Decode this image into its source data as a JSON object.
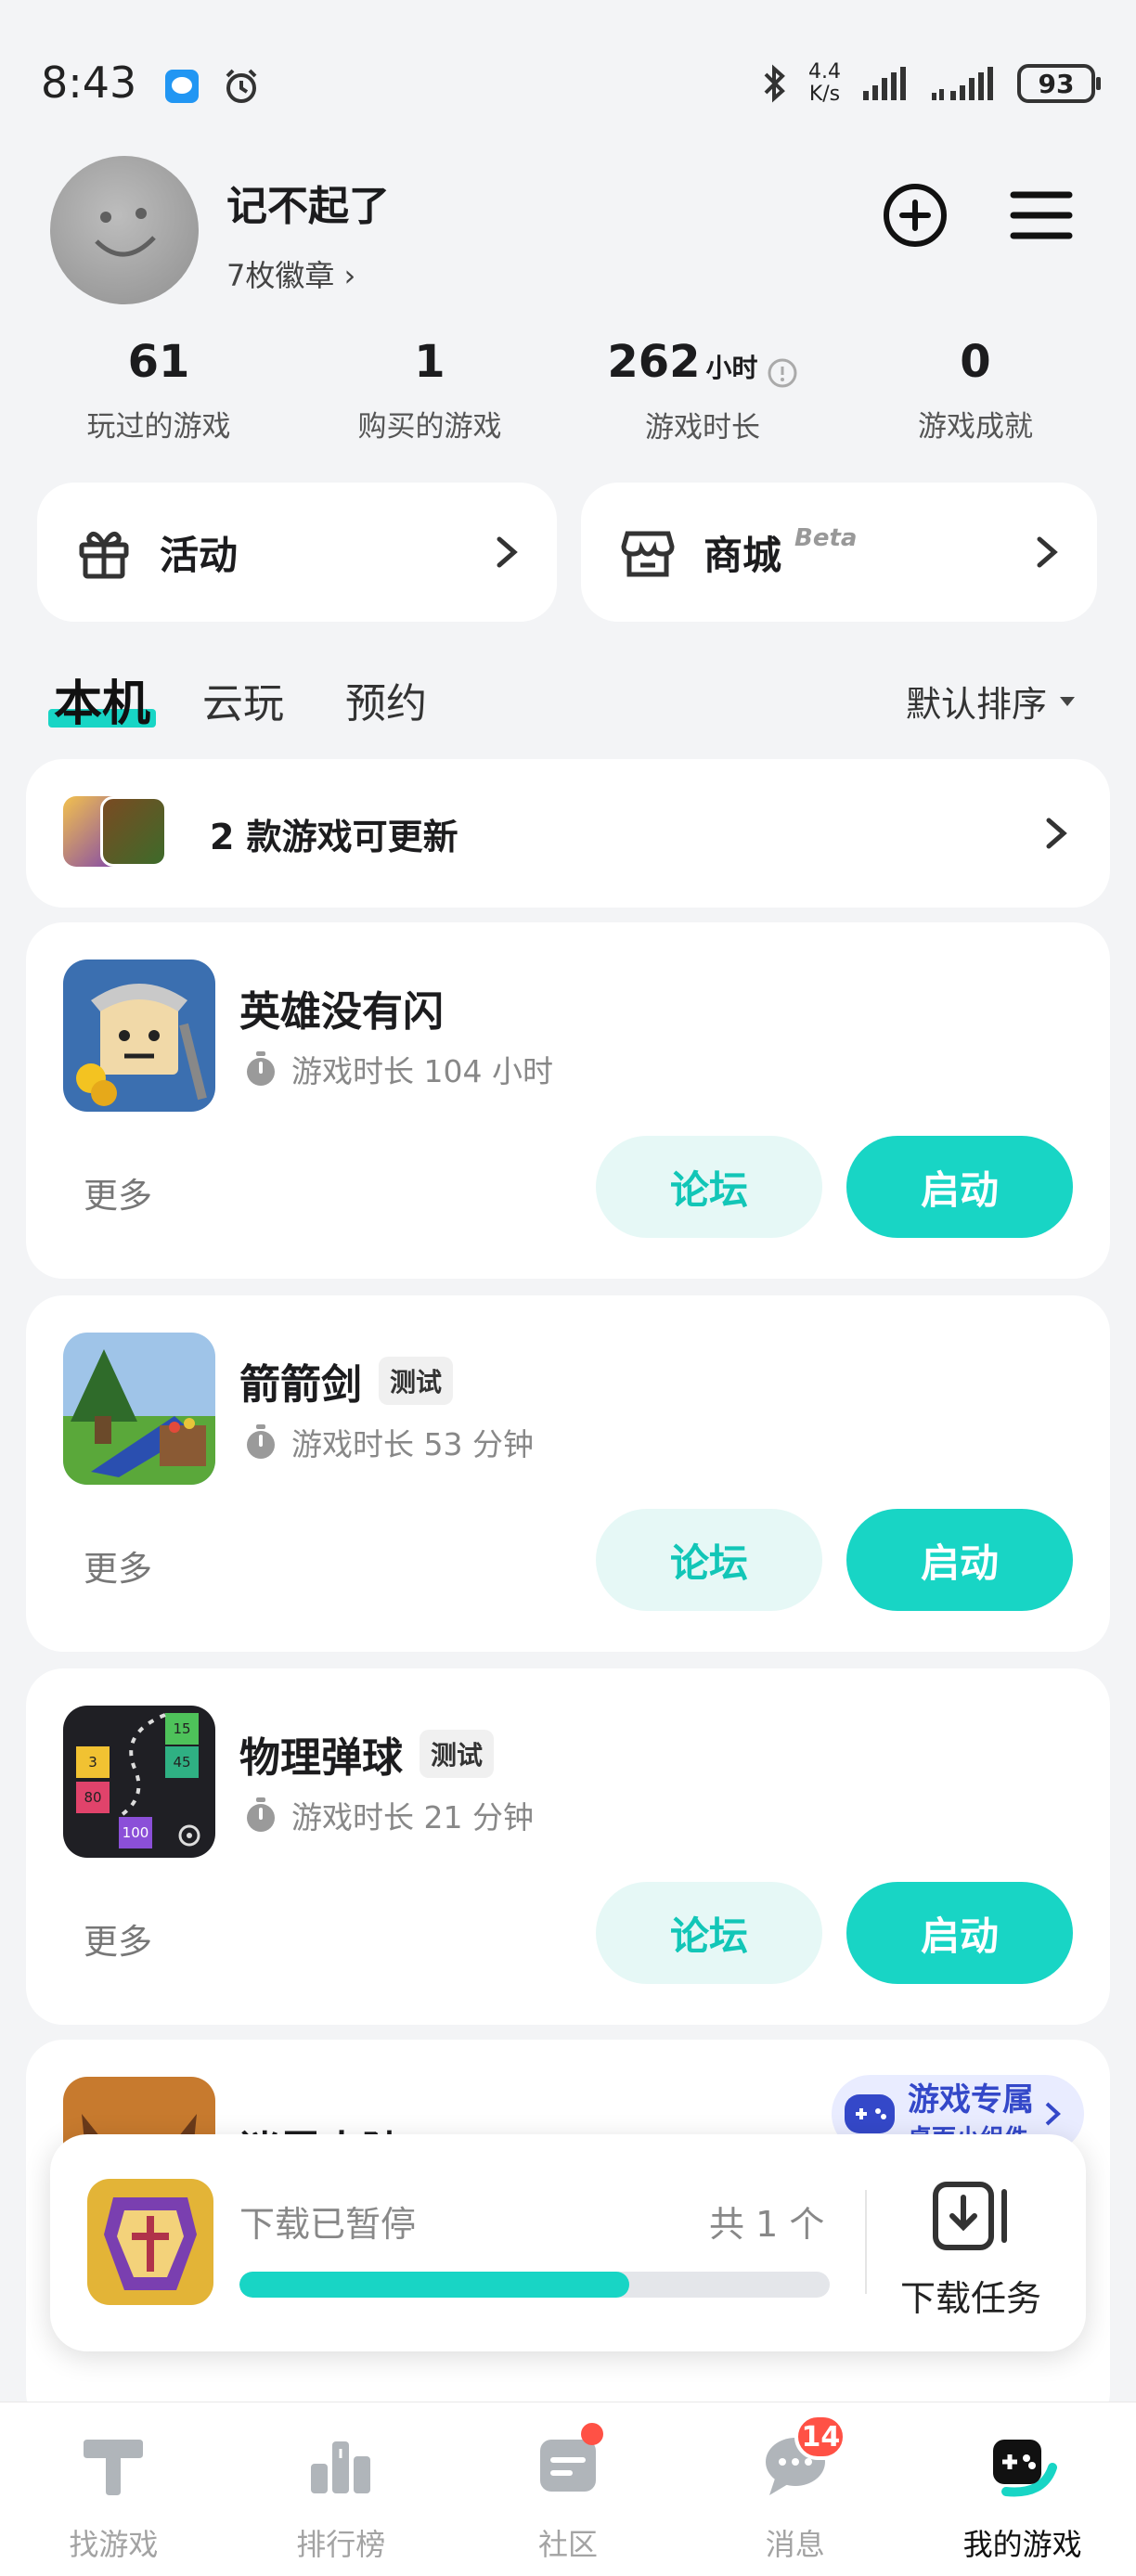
{
  "status_bar": {
    "time": "8:43",
    "net_speed_value": "4.4",
    "net_speed_unit": "K/s",
    "battery": "93"
  },
  "profile": {
    "name": "记不起了",
    "badges": "7枚徽章 ›"
  },
  "stats": [
    {
      "value": "61",
      "unit": "",
      "label": "玩过的游戏"
    },
    {
      "value": "1",
      "unit": "",
      "label": "购买的游戏"
    },
    {
      "value": "262",
      "unit": "小时",
      "label": "游戏时长"
    },
    {
      "value": "0",
      "unit": "",
      "label": "游戏成就"
    }
  ],
  "quick": {
    "events": "活动",
    "mall": "商城",
    "mall_tag": "Beta"
  },
  "tabs": [
    "本机",
    "云玩",
    "预约"
  ],
  "sort_label": "默认排序",
  "update_banner": "2 款游戏可更新",
  "games": [
    {
      "name": "英雄没有闪",
      "tag": "",
      "playtime": "游戏时长 104 小时",
      "more": "更多",
      "forum": "论坛",
      "launch": "启动"
    },
    {
      "name": "箭箭剑",
      "tag": "测试",
      "playtime": "游戏时长 53 分钟",
      "more": "更多",
      "forum": "论坛",
      "launch": "启动"
    },
    {
      "name": "物理弹球",
      "tag": "测试",
      "playtime": "游戏时长 21 分钟",
      "more": "更多",
      "forum": "论坛",
      "launch": "启动"
    }
  ],
  "partial_game": {
    "name": "迷雾大陆",
    "promo_title": "游戏专属",
    "promo_sub": "桌面小组件"
  },
  "pinball_tiles": [
    "15",
    "3",
    "45",
    "80",
    "100"
  ],
  "download": {
    "status": "下载已暂停",
    "count": "共 1 个",
    "progress": 0.66,
    "task_label": "下载任务"
  },
  "nav": [
    {
      "label": "找游戏",
      "icon": "find-game-icon"
    },
    {
      "label": "排行榜",
      "icon": "ranking-icon"
    },
    {
      "label": "社区",
      "icon": "community-icon"
    },
    {
      "label": "消息",
      "icon": "message-icon",
      "badge": "14"
    },
    {
      "label": "我的游戏",
      "icon": "my-games-icon"
    }
  ],
  "colors": {
    "accent": "#18d5c5",
    "badge_red": "#ff5145",
    "page_bg": "#f3f4f6"
  }
}
